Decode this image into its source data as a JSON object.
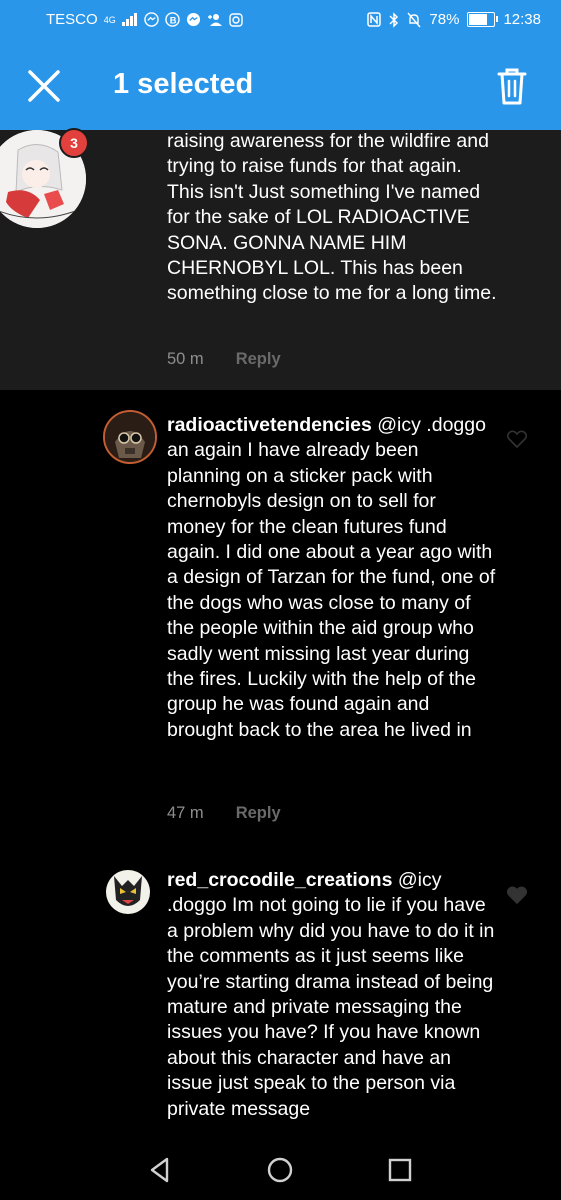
{
  "status_bar": {
    "carrier": "TESCO",
    "network": "4G",
    "battery_percent": "78%",
    "battery_level": 0.78,
    "time": "12:38"
  },
  "app_bar": {
    "title": "1 selected",
    "close_icon": "close-icon",
    "delete_icon": "trash-icon",
    "background_color": "#2a96ea"
  },
  "comments": [
    {
      "badge": "3",
      "text": "raising awareness for the wildfire and trying to raise funds for that again. This isn't Just something I've named for the sake of LOL RADIOACTIVE SONA. GONNA NAME HIM CHERNOBYL LOL. This has been something close to me for a long time.",
      "time": "50 m",
      "reply": "Reply"
    },
    {
      "username": "radioactivetendencies",
      "text": " @icy .doggo an again I have already been planning on a sticker pack with chernobyls design on to sell for money for the clean futures fund again. I did one about a year ago with a design of Tarzan for the fund, one of the dogs who was close to many of the people within the aid group who sadly went missing last year during the fires. Luckily with the help of the group he was found again and brought back to the area he lived in",
      "time": "47 m",
      "reply": "Reply"
    },
    {
      "username": "red_crocodile_creations",
      "text": " @icy .doggo Im not going to lie if you have a problem why did you have to do it in the comments as it just seems like you’re starting drama instead of being mature and private messaging the issues you have? If you have known about this character and have an issue just speak to the person via private message"
    }
  ]
}
